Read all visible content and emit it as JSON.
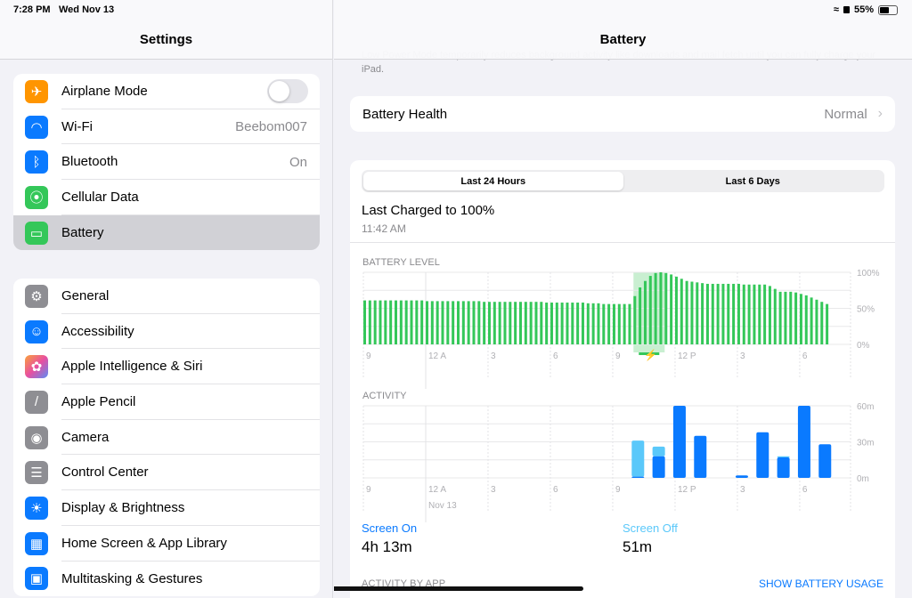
{
  "status": {
    "time": "7:28 PM",
    "date": "Wed Nov 13",
    "battery": "55%",
    "battery_level": 55
  },
  "sidebar": {
    "title": "Settings",
    "group1": [
      {
        "label": "Airplane Mode",
        "icon": "airplane-icon",
        "color": "#ff9500",
        "toggle": false
      },
      {
        "label": "Wi-Fi",
        "icon": "wifi-icon",
        "color": "#0a7aff",
        "value": "Beebom007"
      },
      {
        "label": "Bluetooth",
        "icon": "bluetooth-icon",
        "color": "#0a7aff",
        "value": "On"
      },
      {
        "label": "Cellular Data",
        "icon": "antenna-icon",
        "color": "#34c759"
      },
      {
        "label": "Battery",
        "icon": "battery-icon",
        "color": "#34c759",
        "selected": true
      }
    ],
    "group2": [
      {
        "label": "General",
        "icon": "gear-icon",
        "color": "#8e8e93"
      },
      {
        "label": "Accessibility",
        "icon": "accessibility-icon",
        "color": "#0a7aff"
      },
      {
        "label": "Apple Intelligence & Siri",
        "icon": "apple-intelligence-icon",
        "color": "#e86ab6"
      },
      {
        "label": "Apple Pencil",
        "icon": "pencil-icon",
        "color": "#8e8e93"
      },
      {
        "label": "Camera",
        "icon": "camera-icon",
        "color": "#8e8e93"
      },
      {
        "label": "Control Center",
        "icon": "switches-icon",
        "color": "#8e8e93"
      },
      {
        "label": "Display & Brightness",
        "icon": "sun-icon",
        "color": "#0a7aff"
      },
      {
        "label": "Home Screen & App Library",
        "icon": "home-screen-icon",
        "color": "#0a7aff"
      },
      {
        "label": "Multitasking & Gestures",
        "icon": "multitasking-icon",
        "color": "#0a7aff"
      }
    ]
  },
  "main": {
    "title": "Battery",
    "low_power_note": "Low Power Mode temporarily reduces background activity like downloads and mail fetch until you can fully charge your iPad.",
    "health": {
      "label": "Battery Health",
      "value": "Normal"
    },
    "tabs": [
      {
        "label": "Last 24 Hours",
        "active": true
      },
      {
        "label": "Last 6 Days",
        "active": false
      }
    ],
    "last_charged": "Last Charged to 100%",
    "last_charged_time": "11:42 AM",
    "screen_on": {
      "label": "Screen On",
      "value": "4h 13m"
    },
    "screen_off": {
      "label": "Screen Off",
      "value": "51m"
    },
    "activity_by_app": "ACTIVITY BY APP",
    "show_usage": "SHOW BATTERY USAGE"
  },
  "colors": {
    "green": "#34c759",
    "blue": "#0a7aff",
    "light_blue": "#5ac8fa",
    "charge_band": "#c9efd1"
  },
  "chart_data": [
    {
      "type": "bar",
      "title": "BATTERY LEVEL",
      "ylabel": "",
      "ylim": [
        0,
        100
      ],
      "yticks": [
        "100%",
        "50%",
        "0%"
      ],
      "xticks": [
        "9",
        "12 A",
        "3",
        "6",
        "9",
        "12 P",
        "3",
        "6"
      ],
      "interval": "15 min",
      "start": "9 PM",
      "charging": {
        "from": "10 AM",
        "to": "11:30 AM"
      },
      "values": [
        61,
        61,
        61,
        61,
        61,
        61,
        61,
        61,
        61,
        61,
        61,
        61,
        60,
        60,
        60,
        60,
        60,
        60,
        60,
        60,
        60,
        60,
        60,
        59,
        59,
        59,
        59,
        59,
        59,
        59,
        59,
        59,
        59,
        59,
        59,
        58,
        58,
        58,
        58,
        58,
        58,
        58,
        58,
        57,
        57,
        57,
        56,
        56,
        56,
        56,
        56,
        56,
        67,
        79,
        88,
        95,
        99,
        100,
        99,
        97,
        94,
        91,
        88,
        87,
        86,
        85,
        84,
        84,
        84,
        84,
        84,
        84,
        84,
        83,
        83,
        83,
        83,
        83,
        81,
        77,
        73,
        73,
        73,
        72,
        70,
        68,
        65,
        62,
        59,
        56
      ]
    },
    {
      "type": "bar",
      "title": "ACTIVITY",
      "ylim": [
        0,
        60
      ],
      "yticks": [
        "60m",
        "30m",
        "0m"
      ],
      "xticks": [
        "9",
        "12 A",
        "3",
        "6",
        "9",
        "12 P",
        "3",
        "6"
      ],
      "date_label": "Nov 13",
      "interval": "1 hour",
      "categories": [
        "10 AM",
        "11 AM",
        "12 PM",
        "1 PM",
        "2 PM",
        "3 PM",
        "4 PM",
        "5 PM",
        "6 PM",
        "7 PM"
      ],
      "series": [
        {
          "name": "Screen On",
          "values": [
            1,
            18,
            60,
            35,
            0,
            2,
            38,
            17,
            60,
            28
          ]
        },
        {
          "name": "Screen Off",
          "values": [
            30,
            8,
            0,
            0,
            0,
            0,
            0,
            1,
            0,
            0
          ]
        }
      ]
    }
  ]
}
